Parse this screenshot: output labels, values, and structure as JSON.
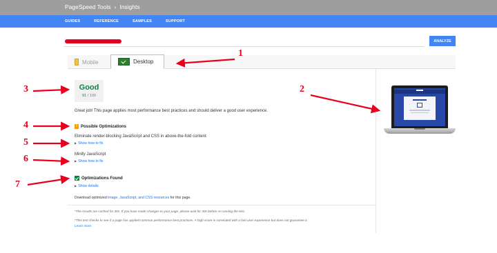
{
  "breadcrumb": {
    "app": "PageSpeed Tools",
    "separator": "›",
    "page": "Insights"
  },
  "nav": [
    "GUIDES",
    "REFERENCE",
    "SAMPLES",
    "SUPPORT"
  ],
  "url_field": {
    "value": ""
  },
  "analyze_label": "ANALYZE",
  "tabs": {
    "mobile": "Mobile",
    "desktop": "Desktop",
    "active": "Desktop"
  },
  "score": {
    "label": "Good",
    "value": "91",
    "max": "/ 100"
  },
  "summary": "Great job! This page applies most performance best practices and should deliver a good user experience.",
  "possible": {
    "heading": "Possible Optimizations",
    "rules": [
      {
        "title": "Eliminate render-blocking JavaScript and CSS in above-the-fold content",
        "link": "Show how to fix"
      },
      {
        "title": "Minify JavaScript",
        "link": "Show how to fix"
      }
    ]
  },
  "found": {
    "heading": "Optimizations Found",
    "link": "Show details"
  },
  "download": {
    "prefix": "Download optimized ",
    "link": "image, JavaScript, and CSS resources",
    "suffix": " for this page."
  },
  "notes": {
    "cache": "*The results are cached for 30s. If you have made changes to your page, please wait for 30s before re-running the test.",
    "test": "*This test checks to see if a page has applied common performance best practices. A high score is correlated with a fast user experience but does not guarantee it.",
    "learn_more": "Learn more."
  },
  "annotations": [
    "1",
    "2",
    "3",
    "4",
    "5",
    "6",
    "7"
  ],
  "colors": {
    "nav": "#4285f4",
    "topbar": "#9e9e9e",
    "good": "#0b8043",
    "warning": "#f4a000",
    "annotation": "#e8001c",
    "link": "#1a73e8"
  }
}
